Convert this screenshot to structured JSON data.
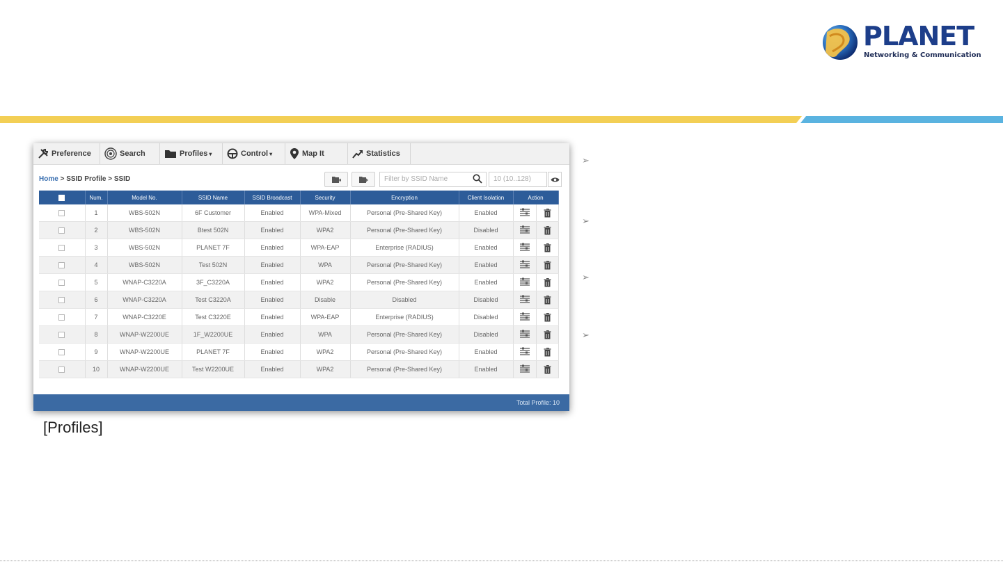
{
  "brand": {
    "name": "PLANET",
    "tagline": "Networking & Communication"
  },
  "caption": "[Profiles]",
  "nav": [
    {
      "label": "Preference",
      "icon": "tools-icon"
    },
    {
      "label": "Search",
      "icon": "radar-icon"
    },
    {
      "label": "Profiles",
      "icon": "folder-icon",
      "dropdown": true
    },
    {
      "label": "Control",
      "icon": "steering-icon",
      "dropdown": true
    },
    {
      "label": "Map It",
      "icon": "map-pin-icon"
    },
    {
      "label": "Statistics",
      "icon": "trend-icon"
    }
  ],
  "breadcrumb": {
    "home": "Home",
    "rest": " > SSID Profile > SSID"
  },
  "toolbar": {
    "filter_placeholder": "Filter by SSID Name",
    "range_placeholder": "10 (10..128)"
  },
  "table": {
    "headers": [
      "",
      "Num.",
      "Model No.",
      "SSID Name",
      "SSID Broadcast",
      "Security",
      "Encryption",
      "Client Isolation",
      "Action"
    ],
    "rows": [
      {
        "num": "1",
        "model": "WBS-502N",
        "ssid": "6F Customer",
        "broadcast": "Enabled",
        "security": "WPA-Mixed",
        "encryption": "Personal (Pre-Shared Key)",
        "isolation": "Enabled"
      },
      {
        "num": "2",
        "model": "WBS-502N",
        "ssid": "Btest 502N",
        "broadcast": "Enabled",
        "security": "WPA2",
        "encryption": "Personal (Pre-Shared Key)",
        "isolation": "Disabled"
      },
      {
        "num": "3",
        "model": "WBS-502N",
        "ssid": "PLANET 7F",
        "broadcast": "Enabled",
        "security": "WPA-EAP",
        "encryption": "Enterprise (RADIUS)",
        "isolation": "Enabled"
      },
      {
        "num": "4",
        "model": "WBS-502N",
        "ssid": "Test 502N",
        "broadcast": "Enabled",
        "security": "WPA",
        "encryption": "Personal (Pre-Shared Key)",
        "isolation": "Enabled"
      },
      {
        "num": "5",
        "model": "WNAP-C3220A",
        "ssid": "3F_C3220A",
        "broadcast": "Enabled",
        "security": "WPA2",
        "encryption": "Personal (Pre-Shared Key)",
        "isolation": "Enabled"
      },
      {
        "num": "6",
        "model": "WNAP-C3220A",
        "ssid": "Test C3220A",
        "broadcast": "Enabled",
        "security": "Disable",
        "encryption": "Disabled",
        "isolation": "Disabled"
      },
      {
        "num": "7",
        "model": "WNAP-C3220E",
        "ssid": "Test C3220E",
        "broadcast": "Enabled",
        "security": "WPA-EAP",
        "encryption": "Enterprise (RADIUS)",
        "isolation": "Disabled"
      },
      {
        "num": "8",
        "model": "WNAP-W2200UE",
        "ssid": "1F_W2200UE",
        "broadcast": "Enabled",
        "security": "WPA",
        "encryption": "Personal (Pre-Shared Key)",
        "isolation": "Disabled"
      },
      {
        "num": "9",
        "model": "WNAP-W2200UE",
        "ssid": "PLANET 7F",
        "broadcast": "Enabled",
        "security": "WPA2",
        "encryption": "Personal (Pre-Shared Key)",
        "isolation": "Enabled"
      },
      {
        "num": "10",
        "model": "WNAP-W2200UE",
        "ssid": "Test W2200UE",
        "broadcast": "Enabled",
        "security": "WPA2",
        "encryption": "Personal (Pre-Shared Key)",
        "isolation": "Enabled"
      }
    ]
  },
  "footer": {
    "total": "Total Profile: 10"
  },
  "colors": {
    "header_blue": "#2d5c99",
    "footer_blue": "#3b6aa3",
    "stripe_yellow": "#f3cf55",
    "stripe_blue": "#5ab3e0",
    "brand_blue": "#1d3e8a"
  }
}
